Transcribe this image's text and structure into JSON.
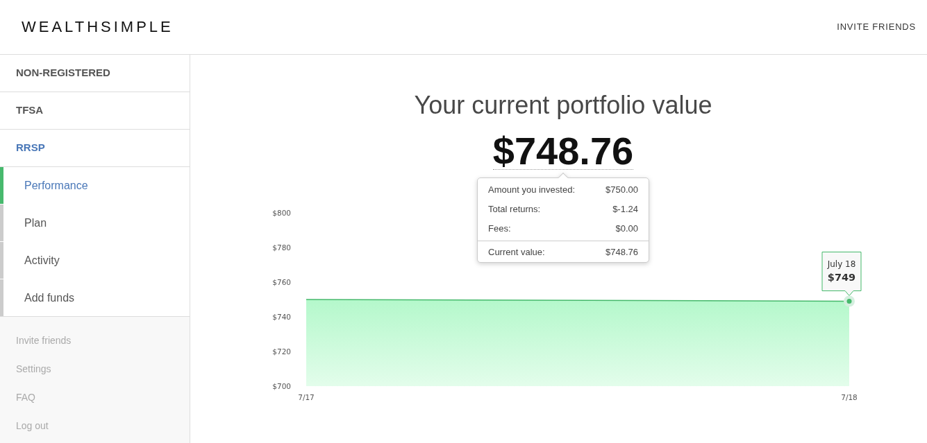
{
  "header": {
    "logo": "WEALTHSIMPLE",
    "invite_link": "INVITE FRIENDS"
  },
  "sidebar": {
    "accounts": [
      {
        "label": "NON-REGISTERED",
        "selected": false
      },
      {
        "label": "TFSA",
        "selected": false
      },
      {
        "label": "RRSP",
        "selected": true,
        "children": [
          {
            "label": "Performance",
            "selected": true
          },
          {
            "label": "Plan",
            "selected": false
          },
          {
            "label": "Activity",
            "selected": false
          },
          {
            "label": "Add funds",
            "selected": false
          }
        ]
      }
    ],
    "footer_links": [
      "Invite friends",
      "Settings",
      "FAQ",
      "Log out"
    ]
  },
  "main": {
    "title": "Your current portfolio value",
    "value": "$748.76",
    "breakdown": {
      "rows": [
        {
          "label": "Amount you invested:",
          "value": "$750.00"
        },
        {
          "label": "Total returns:",
          "value": "$-1.24"
        },
        {
          "label": "Fees:",
          "value": "$0.00"
        }
      ],
      "total": {
        "label": "Current value:",
        "value": "$748.76"
      }
    },
    "chart": {
      "chart_data": {
        "type": "area",
        "categories": [
          "7/17",
          "7/18"
        ],
        "series": [
          {
            "color": "#45b96b",
            "values": [
              750,
              749
            ]
          }
        ],
        "ylim": [
          700,
          800
        ],
        "yticks": [
          {
            "value": 700,
            "label": "$700"
          },
          {
            "value": 720,
            "label": "$720"
          },
          {
            "value": 740,
            "label": "$740"
          },
          {
            "value": 760,
            "label": "$760"
          },
          {
            "value": 780,
            "label": "$780"
          },
          {
            "value": 800,
            "label": "$800"
          }
        ]
      },
      "tooltip": {
        "date": "July 18",
        "value": "$749"
      }
    }
  }
}
